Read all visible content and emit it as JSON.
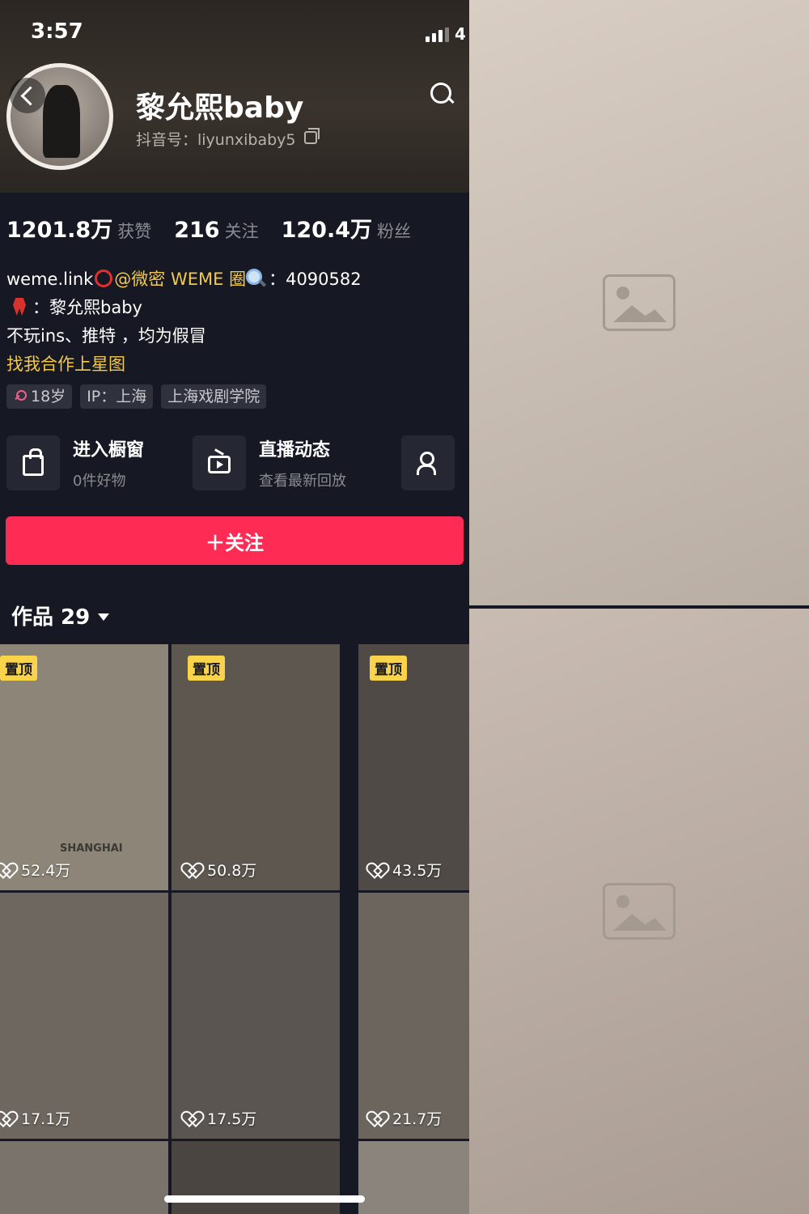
{
  "status_bar": {
    "time": "3:57",
    "battery": "4"
  },
  "profile": {
    "nickname": "黎允熙baby",
    "douyin_id": "抖音号：liyunxibaby5"
  },
  "stats": [
    {
      "value": "1201.8万",
      "label": "获赞"
    },
    {
      "value": "216",
      "label": "关注"
    },
    {
      "value": "120.4万",
      "label": "粉丝"
    }
  ],
  "bio": {
    "line1_prefix": "weme.link",
    "line1_weme": "@微密 WEME 圈",
    "line1_suffix": "：4090582",
    "line2": "：黎允熙baby",
    "line3": "不玩ins、推特 ，均为假冒",
    "line4": "找我合作上星图"
  },
  "tags": {
    "age": "18岁",
    "ip": "IP：上海",
    "school": "上海戏剧学院"
  },
  "actions": {
    "shop_title": "进入橱窗",
    "shop_sub": "0件好物",
    "live_title": "直播动态",
    "live_sub": "查看最新回放"
  },
  "follow_button": "＋关注",
  "works": {
    "label": "作品 29"
  },
  "grid": [
    {
      "likes": "52.4万",
      "pinned": "置顶",
      "overlay": "SHANGHAI"
    },
    {
      "likes": "50.8万",
      "pinned": "置顶"
    },
    {
      "likes": "43.5万",
      "pinned": "置顶"
    },
    {
      "likes": "17.1万"
    },
    {
      "likes": "17.5万"
    },
    {
      "likes": "21.7万"
    }
  ],
  "colors": {
    "background": "#161823",
    "accent": "#fe2c55",
    "pin_badge": "#f9d44a",
    "link": "#f2c94c"
  }
}
